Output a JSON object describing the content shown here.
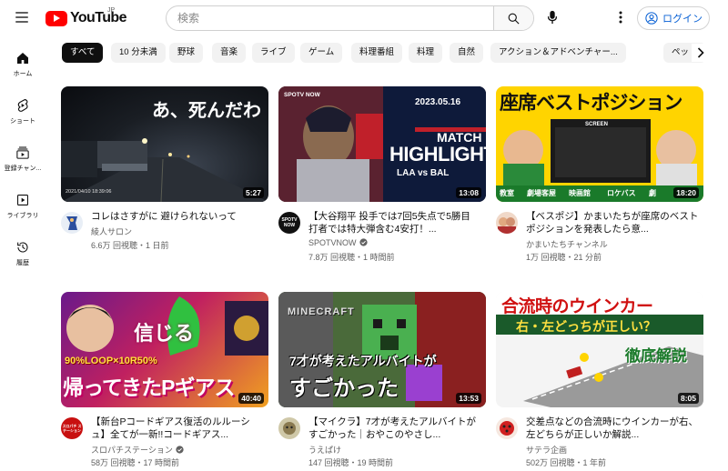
{
  "header": {
    "logo_text": "YouTube",
    "logo_region": "JP",
    "search_placeholder": "検索",
    "login_label": "ログイン"
  },
  "sidebar": {
    "items": [
      {
        "label": "ホーム",
        "icon": "home-icon"
      },
      {
        "label": "ショート",
        "icon": "shorts-icon"
      },
      {
        "label": "登録チャン...",
        "icon": "subscriptions-icon"
      },
      {
        "label": "ライブラリ",
        "icon": "library-icon"
      },
      {
        "label": "履歴",
        "icon": "history-icon"
      }
    ]
  },
  "chips": [
    "すべて",
    "10 分未満",
    "野球",
    "音楽",
    "ライブ",
    "ゲーム",
    "料理番組",
    "料理",
    "自然",
    "アクション＆アドベンチャー...",
    "ペット"
  ],
  "chip_active": "すべて",
  "videos": [
    {
      "title": "コレはさすがに 避けられないって",
      "channel": "綾人サロン",
      "stats": "6.6万 回視聴・1 日前",
      "duration": "5:27",
      "verified": false,
      "thumb_text": "あ、死んだわ",
      "thumb_timestamp": "2021/04/10 18:39:06"
    },
    {
      "title": "【大谷翔平 投手では7回5失点で5勝目 打者では特大弾含む4安打！...",
      "channel": "SPOTVNOW",
      "stats": "7.8万 回視聴・1 時間前",
      "duration": "13:08",
      "verified": true,
      "thumb_date": "2023.05.16",
      "thumb_match": "MATCH",
      "thumb_highlight": "HIGHLIGHT",
      "thumb_teams": "LAA  vs  BAL",
      "thumb_logo": "SPOTV NOW",
      "avatar_text": "SPOTV NOW"
    },
    {
      "title": "【ベスポジ】かまいたちが座席のベストポジションを発表したら意...",
      "channel": "かまいたちチャンネル",
      "stats": "1万 回視聴・21 分前",
      "duration": "18:20",
      "verified": false,
      "thumb_title": "座席ベストポジション",
      "thumb_screen": "SCREEN",
      "thumb_tags": [
        "教室",
        "劇場客屋",
        "映画館",
        "ロケバス",
        "劇"
      ]
    },
    {
      "title": "【新台Pコードギアス復活のルルーシュ】全てが一新!!コードギアス...",
      "channel": "スロパチステーション",
      "stats": "58万 回視聴・17 時間前",
      "duration": "40:40",
      "verified": true,
      "thumb_top": "90%LOOP×10R50%",
      "thumb_main": "帰ってきたPギアス",
      "thumb_kanji": "信じる",
      "avatar_text": "スロパチ ステーション"
    },
    {
      "title": "【マイクラ】7才が考えたアルバイトがすごかった｜おやこのやさし...",
      "channel": "うえぱけ",
      "stats": "147 回視聴・19 時間前",
      "duration": "13:53",
      "verified": false,
      "thumb_logo": "MINECRAFT",
      "thumb_line1": "7才が考えたアルバイトが",
      "thumb_line2": "すごかった"
    },
    {
      "title": "交差点などの合流時にウインカーが右、左どちらが正しいか解説...",
      "channel": "サテラ企画",
      "stats": "502万 回視聴・1 年前",
      "duration": "8:05",
      "verified": false,
      "thumb_title": "合流時のウインカー",
      "thumb_sub": "右・左どっちが正しい？",
      "thumb_badge": "徹底解説"
    }
  ],
  "colors": {
    "brand_red": "#ff0000",
    "link_blue": "#065fd4",
    "text_secondary": "#606060"
  }
}
